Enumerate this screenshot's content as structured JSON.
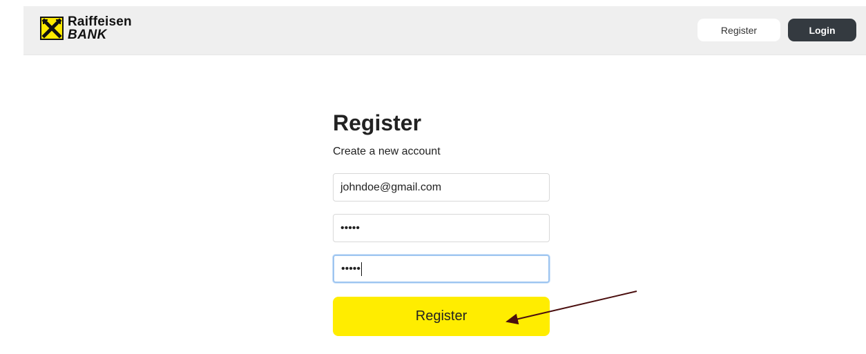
{
  "header": {
    "logo": {
      "line1": "Raiffeisen",
      "line2": "BANK"
    },
    "register_label": "Register",
    "login_label": "Login"
  },
  "form": {
    "title": "Register",
    "subtitle": "Create a new account",
    "email_value": "johndoe@gmail.com",
    "password_value": "•••••",
    "confirm_password_value": "•••••",
    "submit_label": "Register"
  },
  "annotation": {
    "arrow_color": "#4a0e0e",
    "points_to": "submit-button"
  },
  "colors": {
    "brand_yellow": "#ffed00",
    "dark_button": "#343a40",
    "header_bg": "#efefef"
  }
}
